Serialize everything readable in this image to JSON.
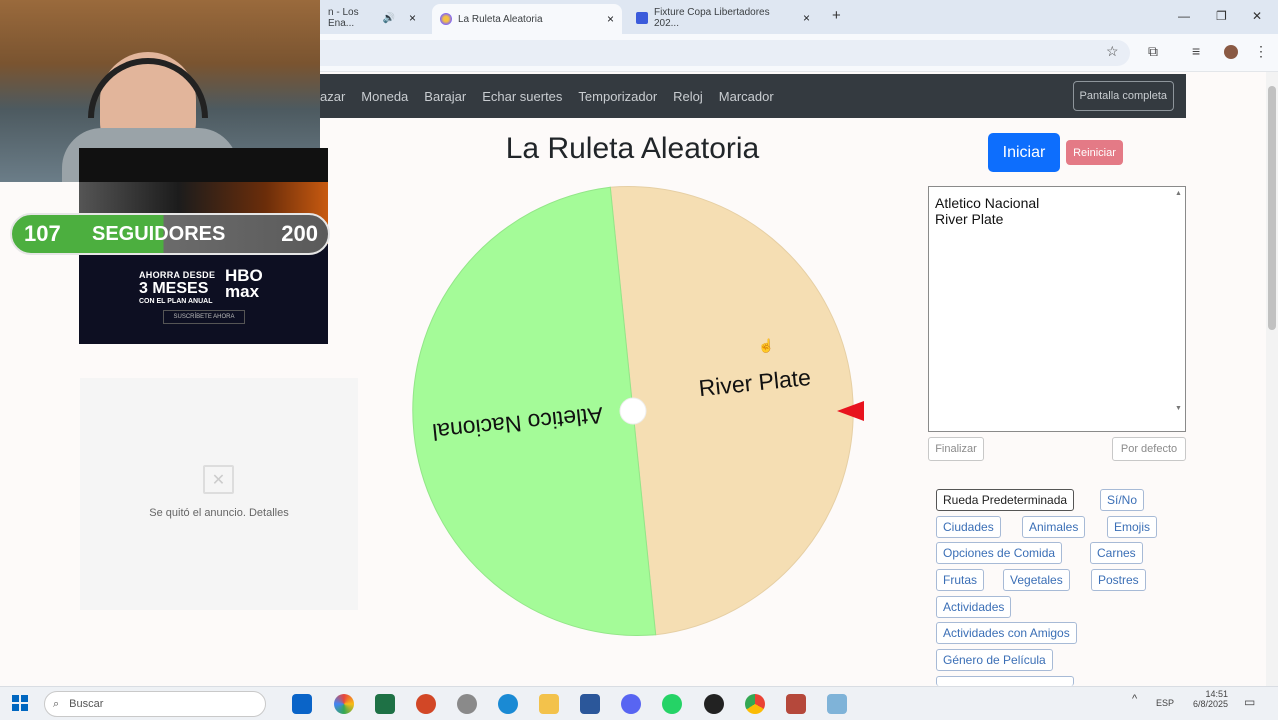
{
  "browser": {
    "tabs": [
      {
        "title": "n - Los Ena...",
        "icon": "audio-icon",
        "active": false
      },
      {
        "title": "La Ruleta Aleatoria",
        "active": true
      },
      {
        "title": "Fixture Copa Libertadores 202...",
        "active": false
      }
    ]
  },
  "nav": {
    "items": [
      "azar",
      "Moneda",
      "Barajar",
      "Echar suertes",
      "Temporizador",
      "Reloj",
      "Marcador"
    ],
    "fullscreen_label": "Pantalla completa"
  },
  "page": {
    "title": "La Ruleta Aleatoria",
    "start_label": "Iniciar",
    "reset_label": "Reiniciar",
    "entries_text": "Atletico Nacional\nRiver Plate",
    "finish_label": "Finalizar",
    "default_label": "Por defecto"
  },
  "wheel": {
    "segments": [
      {
        "label": "River Plate",
        "color": "#f5deb3"
      },
      {
        "label": "Atletico Nacional",
        "color": "#a4fb98"
      }
    ],
    "pointer_color": "#e8131e"
  },
  "presets": [
    "Rueda Predeterminada",
    "Sí/No",
    "Ciudades",
    "Animales",
    "Emojis",
    "Opciones de Comida",
    "Carnes",
    "Frutas",
    "Vegetales",
    "Postres",
    "Actividades",
    "Actividades con Amigos",
    "Género de Película"
  ],
  "overlay": {
    "followers_current": "107",
    "followers_label": "SEGUIDORES",
    "followers_goal": "200",
    "ad_line1": "AHORRA DESDE",
    "ad_line2": "3 MESES",
    "ad_line3": "CON EL PLAN ANUAL",
    "ad_logo_1": "HBO",
    "ad_logo_2": "max",
    "ad_cta": "SUSCRÍBETE AHORA",
    "removed_ad_text": "Se quitó el anuncio. Detalles"
  },
  "taskbar": {
    "search_placeholder": "Buscar",
    "lang": "ESP",
    "time": "14:51",
    "date": "6/8/2025"
  }
}
